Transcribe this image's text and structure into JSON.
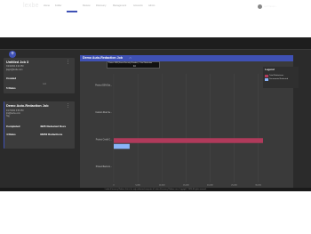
{
  "app": {
    "logo": "lexbe",
    "nav": [
      "Home",
      "Folder",
      "Analysis",
      "Review",
      "Discovery",
      "Management",
      "Accounts",
      "Admin"
    ],
    "active_nav": "Analysis",
    "user_name": "Jeff Tamm..."
  },
  "left_panel": {
    "add_symbol": "+",
    "cards": [
      {
        "title": "Untitled Job 3",
        "date": "3/23/2024 3:24 PM",
        "email": "jtagm@lexbe.com",
        "status_label": "Created",
        "rules_label": "5 Rules",
        "extra": "Add",
        "kebab": "⋮"
      },
      {
        "title": "Demo Auto-Redaction Job",
        "date": "4/17/2024 3:56 PM",
        "email": "jtm@lexbe.com",
        "sub_label": "Tag",
        "status_label": "Completed",
        "rules_label": "4 Rules",
        "redacted_docs": "4935 Redacted Docs",
        "redactions": "33952 Redactions",
        "kebab": "⋮"
      }
    ]
  },
  "chart_panel": {
    "title": "Demo Auto-Redaction Job",
    "title_icon": "⇔",
    "tooltip_text": "Protect 18M (Social Security Number) - Total Redaction",
    "tooltip_value": "14",
    "legend_title": "Legend",
    "colors": {
      "header": "#3f51b5",
      "series1": "#b03a5b",
      "series2": "#8ab4f8"
    }
  },
  "chart_data": {
    "type": "bar",
    "orientation": "horizontal",
    "categories": [
      "Protect SSN Dat...",
      "Custom Rule Se...",
      "Protect Credit C...",
      "Protect Bank Ac..."
    ],
    "series": [
      {
        "name": "Total Redactions",
        "values": [
          0,
          0,
          31000,
          0
        ]
      },
      {
        "name": "Documents Redacted",
        "values": [
          0,
          0,
          3300,
          0
        ]
      }
    ],
    "x_ticks": [
      "0",
      "5,000",
      "10,000",
      "15,000",
      "20,000",
      "25,000",
      "30,000"
    ],
    "xlim": [
      0,
      31000
    ],
    "legend_position": "top-right"
  },
  "footer": {
    "text": "Lexbe eDiscovery Platform Unit is the only authorised computer of Lexbe eDiscovery Platform user. Copyright © 2024 All rights reserved."
  }
}
